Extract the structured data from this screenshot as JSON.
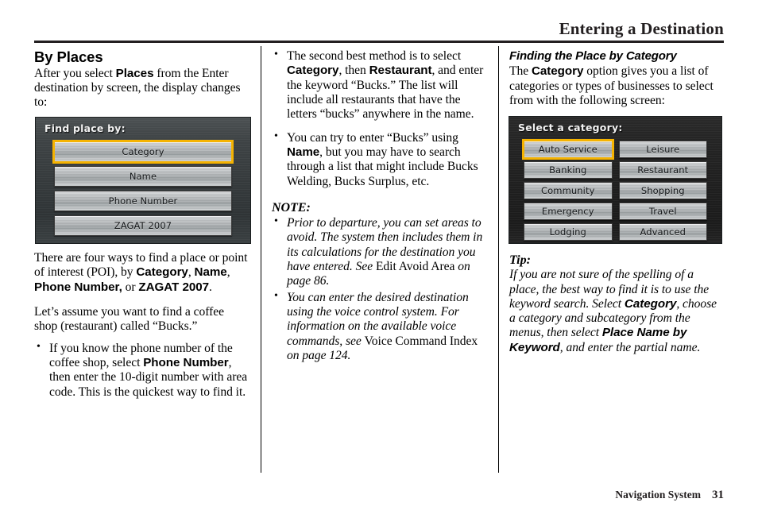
{
  "header": {
    "title": "Entering a Destination"
  },
  "footer": {
    "label": "Navigation System",
    "page_number": "31"
  },
  "column1": {
    "heading": "By Places",
    "intro_pre": "After you select ",
    "intro_bold1": "Places",
    "intro_mid": " from the Enter destination by",
    "intro_post": " screen, the display changes to:",
    "screen": {
      "title": "Find place by:",
      "buttons": [
        {
          "label": "Category",
          "selected": true
        },
        {
          "label": "Name",
          "selected": false
        },
        {
          "label": "Phone Number",
          "selected": false
        },
        {
          "label": "ZAGAT 2007",
          "selected": false
        }
      ],
      "highlight_color": "#f5b301"
    },
    "para_four_ways_pre": "There are four ways to find a place or point of interest (POI), by ",
    "para_four_ways_b1": "Category",
    "para_four_ways_sep1": ", ",
    "para_four_ways_b2": "Name",
    "para_four_ways_sep2": ", ",
    "para_four_ways_b3": "Phone Number,",
    "para_four_ways_sep3": " or ",
    "para_four_ways_b4": "ZAGAT 2007",
    "para_four_ways_end": ".",
    "para_assume": "Let’s assume you want to find a coffee shop (restaurant) called “Bucks.”",
    "bullet1_pre": "If you know the phone number of the coffee shop, select ",
    "bullet1_bold": "Phone Number",
    "bullet1_post": ", then enter the 10-digit number with area code. This is the quickest way to find it."
  },
  "column2": {
    "bullet1_pre": "The second best method is to select ",
    "bullet1_b1": "Category",
    "bullet1_mid": ", then ",
    "bullet1_b2": "Restaurant",
    "bullet1_post": ", and enter the keyword “Bucks.” The list will include all restaurants that have the letters “bucks” anywhere in the name.",
    "bullet2_pre": "You can try to enter “Bucks” using ",
    "bullet2_bold": "Name",
    "bullet2_post": ", but you may have to search through a list that might include Bucks Welding, Bucks Surplus, etc.",
    "note_heading": "NOTE:",
    "note1_pre": "Prior to departure, you can set areas to avoid. The system then includes them in its calculations for the destination you have entered. See ",
    "note1_roman": "Edit Avoid Area",
    "note1_post": " on page 86.",
    "note2_pre": "You can enter the desired destination using the voice control system. For information on the available voice commands, see ",
    "note2_roman": "Voice Command Index",
    "note2_post": " on page 124."
  },
  "column3": {
    "heading": "Finding the Place by Category",
    "intro_pre": "The ",
    "intro_bold": "Category",
    "intro_post": " option gives you a list of categories or types of businesses to select from with the following screen:",
    "screen": {
      "title": "Select a category:",
      "buttons_left": [
        {
          "label": "Auto Service",
          "selected": true
        },
        {
          "label": "Banking",
          "selected": false
        },
        {
          "label": "Community",
          "selected": false
        },
        {
          "label": "Emergency",
          "selected": false
        },
        {
          "label": "Lodging",
          "selected": false
        }
      ],
      "buttons_right": [
        {
          "label": "Leisure",
          "selected": false
        },
        {
          "label": "Restaurant",
          "selected": false
        },
        {
          "label": "Shopping",
          "selected": false
        },
        {
          "label": "Travel",
          "selected": false
        },
        {
          "label": "Advanced",
          "selected": false
        }
      ],
      "highlight_color": "#f5b301"
    },
    "tip_heading": "Tip:",
    "tip_pre": "If you are not sure of the spelling of a place, the best way to find it is to use the keyword search. Select ",
    "tip_b1": "Category",
    "tip_mid": ", choose a category and subcategory from the menus, then select ",
    "tip_b2": "Place Name by Keyword",
    "tip_post": ", and enter the partial name."
  }
}
